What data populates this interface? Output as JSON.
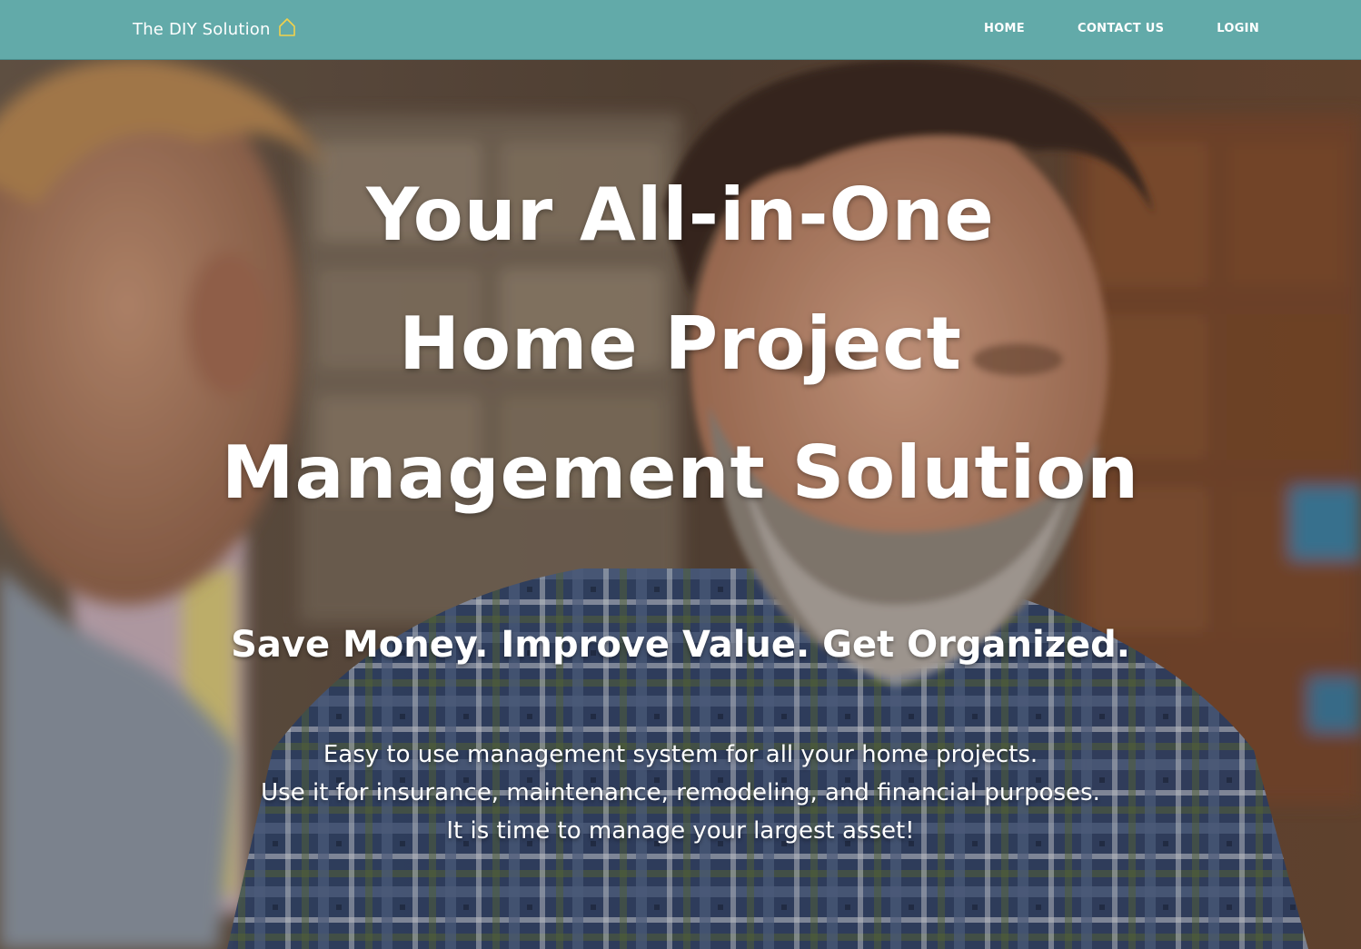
{
  "nav": {
    "brand": "The DIY Solution",
    "brand_icon": "home-icon",
    "links": [
      {
        "label": "HOME"
      },
      {
        "label": "CONTACT US"
      },
      {
        "label": "LOGIN"
      }
    ]
  },
  "hero": {
    "headline": [
      "Your All-in-One",
      "Home Project",
      "Management Solution"
    ],
    "tagline": "Save Money. Improve Value. Get Organized.",
    "description": [
      "Easy to use management system for all your home projects.",
      "Use it for insurance, maintenance, remodeling, and financial purposes.",
      "It is time to manage your largest asset!"
    ]
  },
  "colors": {
    "navbar": "#62aaa9",
    "brand_icon": "#f2d14b",
    "text": "#ffffff"
  }
}
